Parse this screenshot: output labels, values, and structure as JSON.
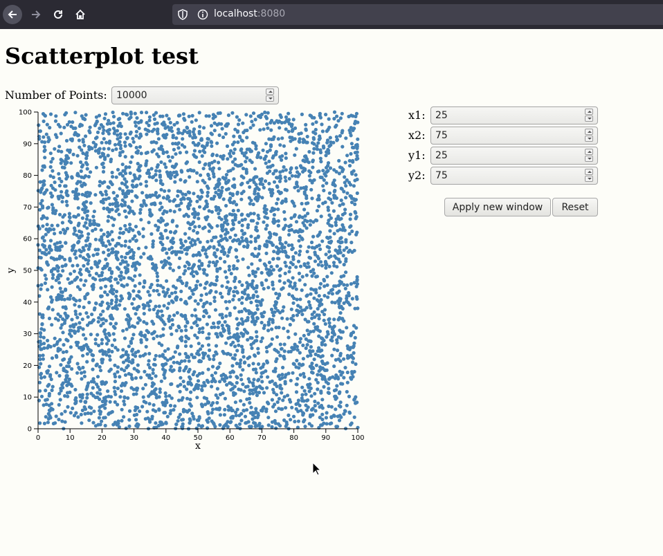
{
  "browser": {
    "url_host": "localhost",
    "url_port": ":8080"
  },
  "page": {
    "title": "Scatterplot test",
    "points_label": "Number of Points:",
    "points_value": "10000",
    "window": {
      "x1": {
        "label": "x1:",
        "value": "25"
      },
      "x2": {
        "label": "x2:",
        "value": "75"
      },
      "y1": {
        "label": "y1:",
        "value": "25"
      },
      "y2": {
        "label": "y2:",
        "value": "75"
      }
    },
    "apply_label": "Apply new window",
    "reset_label": "Reset"
  },
  "chart_data": {
    "type": "scatter",
    "title": "",
    "xlabel": "x",
    "ylabel": "y",
    "xlim": [
      0,
      100
    ],
    "ylim": [
      0,
      100
    ],
    "x_ticks": [
      "0",
      "10",
      "20",
      "30",
      "40",
      "50",
      "60",
      "70",
      "80",
      "90",
      "100"
    ],
    "y_ticks": [
      "0",
      "10",
      "20",
      "30",
      "40",
      "50",
      "60",
      "70",
      "80",
      "90",
      "100"
    ],
    "point_count": 10000,
    "distribution": "uniform random over [0,100] x [0,100]",
    "color": "#4682b4",
    "grid": false
  }
}
